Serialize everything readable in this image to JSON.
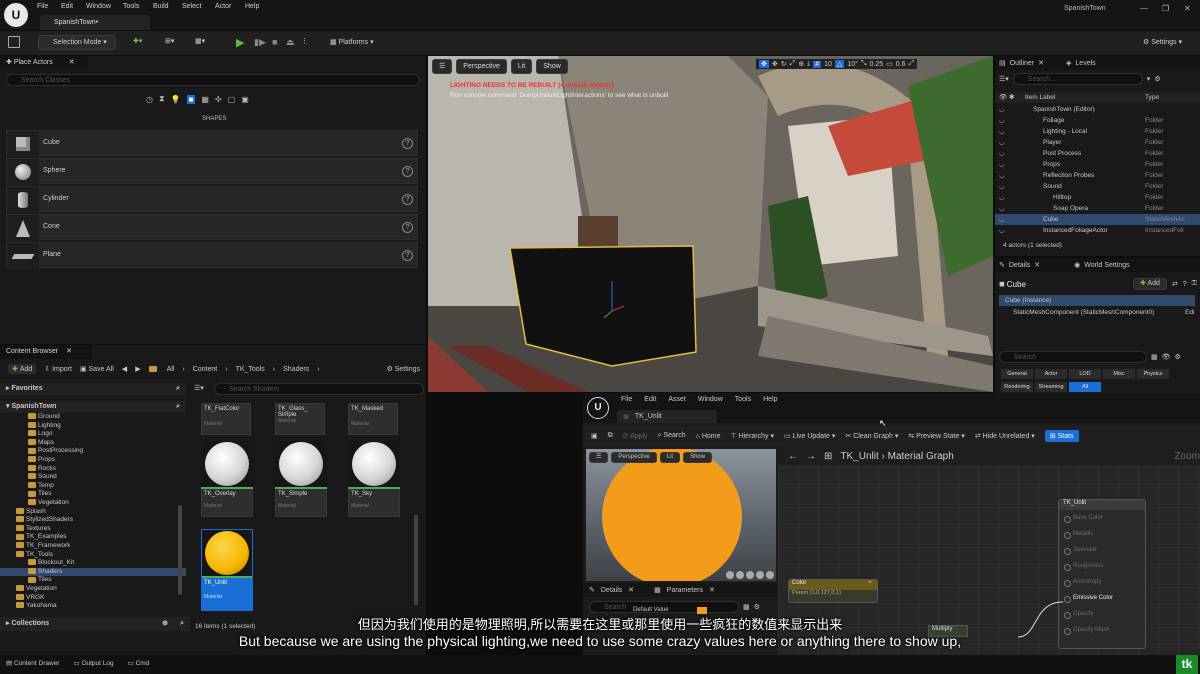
{
  "titlebar": {
    "logo": "U",
    "menus": [
      "File",
      "Edit",
      "Window",
      "Tools",
      "Build",
      "Select",
      "Actor",
      "Help"
    ],
    "tab": "SpanishTown•",
    "project": "SpanishTown"
  },
  "toolbar": {
    "selection_mode": "Selection Mode",
    "platforms": "Platforms",
    "settings": "Settings"
  },
  "place_actors": {
    "title": "Place Actors",
    "search_placeholder": "Search Classes",
    "category": "SHAPES",
    "shapes": [
      "Cube",
      "Sphere",
      "Cylinder",
      "Cone",
      "Plane"
    ]
  },
  "content_browser": {
    "title": "Content Browser",
    "add": "Add",
    "import": "Import",
    "save_all": "Save All",
    "breadcrumb": [
      "All",
      "Content",
      "TK_Tools",
      "Shaders"
    ],
    "settings": "Settings",
    "favorites": "Favorites",
    "root": "SpanishTown",
    "search_placeholder": "Search Shaders",
    "tree": [
      {
        "label": "Ground",
        "depth": 2
      },
      {
        "label": "Lighting",
        "depth": 2
      },
      {
        "label": "Logo",
        "depth": 2
      },
      {
        "label": "Maps",
        "depth": 2
      },
      {
        "label": "PostProcessing",
        "depth": 2
      },
      {
        "label": "Props",
        "depth": 2
      },
      {
        "label": "Rocks",
        "depth": 2
      },
      {
        "label": "Sound",
        "depth": 2
      },
      {
        "label": "Temp",
        "depth": 2
      },
      {
        "label": "Tiles",
        "depth": 2
      },
      {
        "label": "Vegetation",
        "depth": 2
      },
      {
        "label": "Splash",
        "depth": 1
      },
      {
        "label": "StylizedShaders",
        "depth": 1
      },
      {
        "label": "Textures",
        "depth": 1
      },
      {
        "label": "TK_Examples",
        "depth": 1
      },
      {
        "label": "TK_Framework",
        "depth": 1
      },
      {
        "label": "TK_Tools",
        "depth": 1
      },
      {
        "label": "Blockout_Kit",
        "depth": 2
      },
      {
        "label": "Shaders",
        "depth": 2
      },
      {
        "label": "Tiles",
        "depth": 2
      },
      {
        "label": "Vegetation",
        "depth": 1
      },
      {
        "label": "VRGK",
        "depth": 1
      },
      {
        "label": "Yakohama",
        "depth": 1
      }
    ],
    "assets": [
      {
        "name": "TK_FlatColor",
        "type": "Material"
      },
      {
        "name": "TK_Glass_ Simple",
        "type": "Material"
      },
      {
        "name": "TK_Masked",
        "type": "Material"
      },
      {
        "name": "TK_Overlay",
        "type": "Material"
      },
      {
        "name": "TK_Simple",
        "type": "Material"
      },
      {
        "name": "TK_Sky",
        "type": "Material"
      },
      {
        "name": "TK_Unlit",
        "type": "Material"
      }
    ],
    "item_count": "16 items (1 selected)",
    "collections": "Collections"
  },
  "viewport": {
    "perspective": "Perspective",
    "lit": "Lit",
    "show": "Show",
    "warning": "LIGHTING NEEDS TO BE REBUILT (4 unbuilt objects)",
    "hint": "Run console command 'DumpUnbuiltLightInteractions' to see what is unbuilt",
    "grid": "10",
    "angle": "10°",
    "scale": "0.25",
    "speed": "0.6"
  },
  "outliner": {
    "title": "Outliner",
    "levels": "Levels",
    "search_placeholder": "Search...",
    "col_label": "Item Label",
    "col_type": "Type",
    "rows": [
      {
        "label": "SpanishTown (Editor)",
        "type": "",
        "depth": 0
      },
      {
        "label": "Foliage",
        "type": "Folder",
        "depth": 1
      },
      {
        "label": "Lighting - Local",
        "type": "Folder",
        "depth": 1
      },
      {
        "label": "Player",
        "type": "Folder",
        "depth": 1
      },
      {
        "label": "Post Process",
        "type": "Folder",
        "depth": 1
      },
      {
        "label": "Props",
        "type": "Folder",
        "depth": 1
      },
      {
        "label": "Reflection Probes",
        "type": "Folder",
        "depth": 1
      },
      {
        "label": "Sound",
        "type": "Folder",
        "depth": 1
      },
      {
        "label": "Hilltop",
        "type": "Folder",
        "depth": 2
      },
      {
        "label": "Soap Opera",
        "type": "Folder",
        "depth": 2
      },
      {
        "label": "Cube",
        "type": "StaticMeshAc",
        "depth": 1
      },
      {
        "label": "InstancedFoliageActor",
        "type": "InstancedFoli",
        "depth": 1
      }
    ],
    "count": "4 actors (1 selected)"
  },
  "details": {
    "title": "Details",
    "world_settings": "World Settings",
    "object": "Cube",
    "add": "Add",
    "instance": "Cube (Instance)",
    "component": "StaticMeshComponent (StaticMeshComponent0)",
    "edit": "Edi",
    "search_placeholder": "Search",
    "filters": [
      "General",
      "Actor",
      "LOD",
      "Misc",
      "Physics",
      "Rendering",
      "Streaming",
      "All"
    ]
  },
  "material_editor": {
    "menus": [
      "File",
      "Edit",
      "Asset",
      "Window",
      "Tools",
      "Help"
    ],
    "tab": "TK_Unlit",
    "tools": [
      "Apply",
      "Search",
      "Home",
      "Hierarchy",
      "Live Update",
      "Clean Graph",
      "Preview State",
      "Hide Unrelated"
    ],
    "stats": "Stats",
    "preview_perspective": "Perspective",
    "preview_lit": "Lit",
    "preview_show": "Show",
    "details_tab": "Details",
    "parameters_tab": "Parameters",
    "search_placeholder": "Search",
    "default_value": "Default Value",
    "breadcrumb_root": "TK_Unlit",
    "breadcrumb_leaf": "Material Graph",
    "zoom": "Zoom",
    "color_node": "Color",
    "color_node_sub": "Param (1,0.127,0,1)",
    "output_node": "TK_Unlit",
    "pins": [
      "Base Color",
      "Metallic",
      "Specular",
      "Roughness",
      "Anisotropy",
      "Emissive Color",
      "Opacity",
      "Opacity Mask"
    ],
    "multiply_node": "Multiply"
  },
  "subtitles": {
    "chinese": "但因为我们使用的是物理照明,所以需要在这里或那里使用一些疯狂的数值来显示出来",
    "english": "But because we are using the physical lighting,we need to use some crazy values here or anything there to show up,"
  },
  "bottombar": {
    "content_drawer": "Content Drawer",
    "output_log": "Output Log",
    "cmd": "Cmd"
  },
  "watermark": "tk",
  "colors": {
    "accent": "#1a6fd6",
    "orange": "#f39c1c",
    "warning": "#e02020",
    "selection_outline": "#e8b84a"
  }
}
